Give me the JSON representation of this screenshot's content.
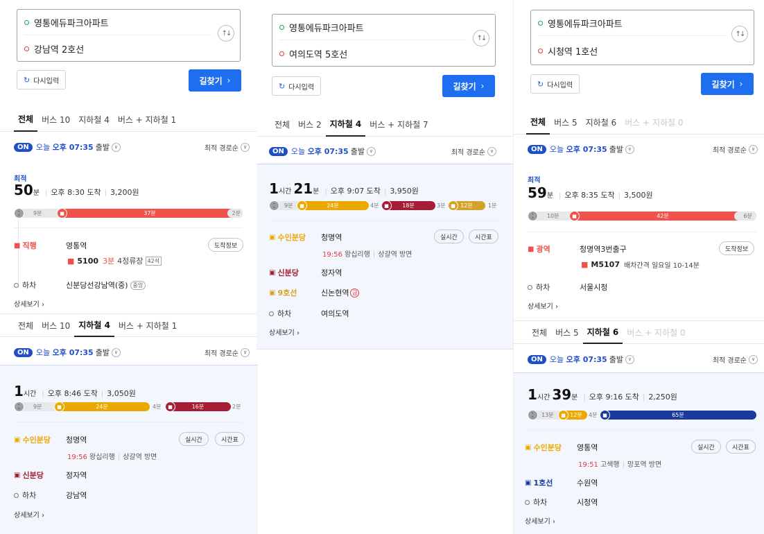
{
  "origin": "영통에듀파크아파트",
  "reset_label": "다시입력",
  "find_label": "길찾기",
  "now_badge": "ON",
  "today": "오늘",
  "time": "오후 07:35",
  "depart": "출발",
  "sort": "최적 경로순",
  "detail": "상세보기",
  "board_off": "하차",
  "realtime": "실시간",
  "timetable": "시간표",
  "stopinfo": "도착정보",
  "best_label": "최적",
  "p1": {
    "dest": "강남역 2호선",
    "tabs": [
      "전체",
      "버스 10",
      "지하철 4",
      "버스 + 지하철 1"
    ],
    "r1": {
      "n1": "50",
      "u1": "분",
      "arr": "오후 8:30 도착",
      "fare": "3,200원",
      "segs": [
        "9분",
        "37분",
        "2분"
      ],
      "leg_label": "직행",
      "leg_stn": "영통역",
      "bus_no": "5100",
      "bus_eta": "3분",
      "bus_stop": "4정류장",
      "bus_seat": "42석",
      "off_stn": "신분당선강남역(중)",
      "off_tag": "중앙"
    },
    "r2": {
      "n1": "1",
      "u1": "시간",
      "arr": "오후 8:46 도착",
      "fare": "3,050원",
      "segs": [
        "9분",
        "24분",
        "4분",
        "16분",
        "2분"
      ],
      "l1_label": "수인분당",
      "l1_stn": "청명역",
      "l1_time": "19:56",
      "l1_dir": "왕십리행",
      "l1_plat": "상갈역 방면",
      "l2_label": "신분당",
      "l2_stn": "정자역",
      "off_stn": "강남역"
    }
  },
  "p2": {
    "dest": "여의도역 5호선",
    "tabs": [
      "전체",
      "버스 2",
      "지하철 4",
      "버스 + 지하철 7"
    ],
    "r1": {
      "n1": "1",
      "u1": "시간",
      "n2": "21",
      "u2": "분",
      "arr": "오후 9:07 도착",
      "fare": "3,950원",
      "segs": [
        "9분",
        "24분",
        "4분",
        "18분",
        "3분",
        "12분",
        "1분"
      ],
      "l1_label": "수인분당",
      "l1_stn": "청명역",
      "l1_time": "19:56",
      "l1_dir": "왕십리행",
      "l1_plat": "상갈역 방면",
      "l2_label": "신분당",
      "l2_stn": "정자역",
      "l3_label": "9호선",
      "l3_stn": "신논현역",
      "l3_tag": "급",
      "off_stn": "여의도역"
    }
  },
  "p3": {
    "dest": "시청역 1호선",
    "tabs": [
      "전체",
      "버스 5",
      "지하철 6",
      "버스 + 지하철 0"
    ],
    "r1": {
      "n1": "59",
      "u1": "분",
      "arr": "오후 8:35 도착",
      "fare": "3,500원",
      "segs": [
        "10분",
        "42분",
        "6분"
      ],
      "leg_label": "광역",
      "leg_stn": "청명역3번출구",
      "bus_no": "M5107",
      "bus_note": "배차간격 일요일 10-14분",
      "off_stn": "서울시청"
    },
    "r2": {
      "n1": "1",
      "u1": "시간",
      "n2": "39",
      "u2": "분",
      "arr": "오후 9:16 도착",
      "fare": "2,250원",
      "segs": [
        "13분",
        "12분",
        "4분",
        "65분"
      ],
      "l1_label": "수인분당",
      "l1_stn": "영통역",
      "l1_time": "19:51",
      "l1_dir": "고색행",
      "l1_plat": "망포역 방면",
      "l2_label": "1호선",
      "l2_stn": "수원역",
      "off_stn": "시청역"
    }
  },
  "colors": {
    "bus_red": "#f0524b",
    "suin": "#eba900",
    "sinbundang": "#a51e35",
    "line9": "#d4a228",
    "line1": "#1b3a9b",
    "blue": "#1e4ec8"
  }
}
